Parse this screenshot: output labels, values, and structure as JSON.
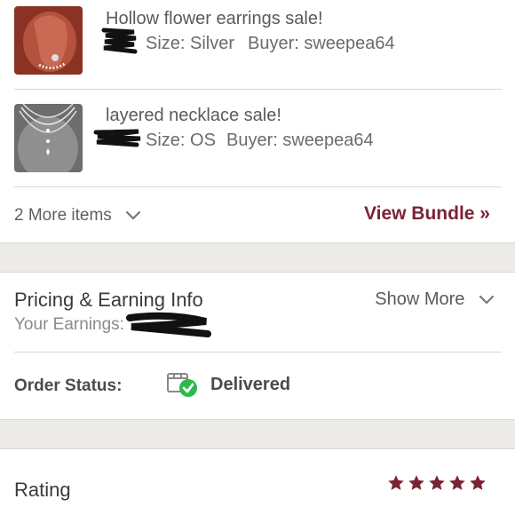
{
  "items": [
    {
      "title": "Hollow flower earrings sale!",
      "size_label": "Size: Silver",
      "buyer_label": "Buyer: sweepea64",
      "thumb_icon": "earrings-photo"
    },
    {
      "title": "layered necklace sale!",
      "size_label": "Size: OS",
      "buyer_label": "Buyer: sweepea64",
      "thumb_icon": "necklace-photo"
    }
  ],
  "bundle": {
    "more_items_label": "2 More items",
    "view_bundle_label": "View Bundle »"
  },
  "pricing": {
    "title": "Pricing & Earning Info",
    "earnings_label": "Your Earnings:",
    "show_more_label": "Show More"
  },
  "order": {
    "status_label": "Order Status:",
    "status_value": "Delivered",
    "status_icon": "box-delivered-icon"
  },
  "rating": {
    "label": "Rating",
    "stars": 5,
    "max_stars": 5
  },
  "colors": {
    "brand": "#7b2334",
    "success": "#2db84d",
    "band": "#ecebe8"
  }
}
